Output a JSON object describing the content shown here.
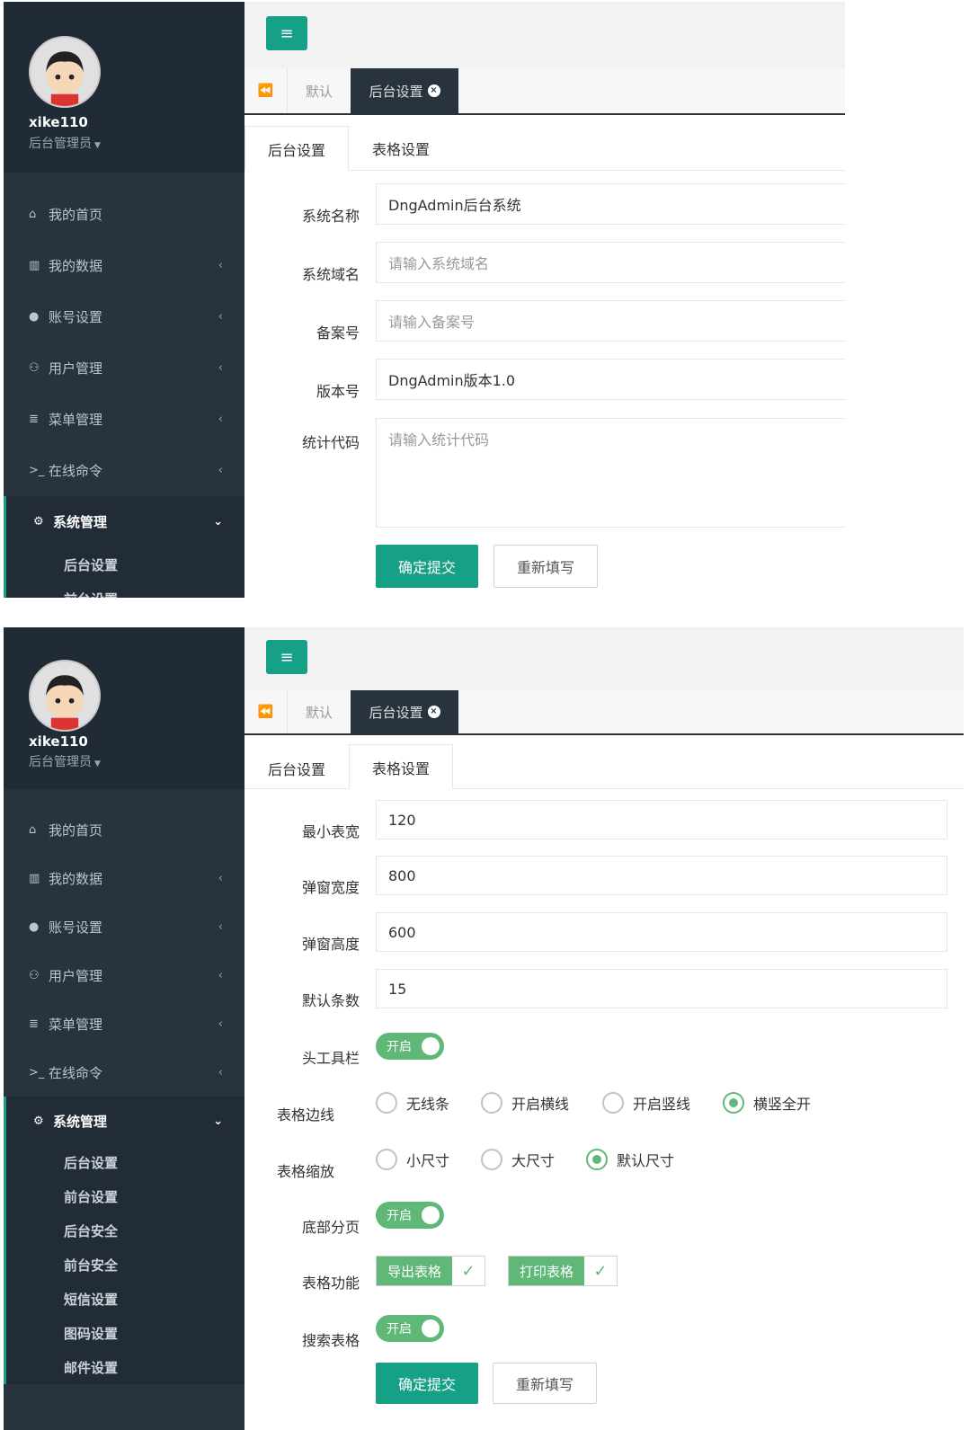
{
  "user": {
    "name": "xike110",
    "role": "后台管理员"
  },
  "menu": {
    "items": [
      {
        "label": "我的首页",
        "icon": "home-icon",
        "glyph": "⌂"
      },
      {
        "label": "我的数据",
        "icon": "bar-chart-icon",
        "glyph": "▥",
        "arrow": "‹"
      },
      {
        "label": "账号设置",
        "icon": "user-icon",
        "glyph": "●",
        "arrow": "‹"
      },
      {
        "label": "用户管理",
        "icon": "users-icon",
        "glyph": "⚇",
        "arrow": "‹"
      },
      {
        "label": "菜单管理",
        "icon": "list-icon",
        "glyph": "≣",
        "arrow": "‹"
      },
      {
        "label": "在线命令",
        "icon": "terminal-icon",
        "glyph": ">_",
        "arrow": "‹"
      },
      {
        "label": "系统管理",
        "icon": "gear-icon",
        "glyph": "⚙",
        "arrow": "⌄"
      }
    ],
    "submenu": [
      "后台设置",
      "前台设置",
      "后台安全",
      "前台安全",
      "短信设置",
      "图码设置",
      "邮件设置"
    ]
  },
  "header": {
    "menu_toggle_glyph": "≡"
  },
  "tabs": {
    "back_glyph": "⏪",
    "default": "默认",
    "active": "后台设置",
    "close_glyph": "×"
  },
  "subtabs": {
    "backend": "后台设置",
    "table": "表格设置"
  },
  "panel1": {
    "fields": {
      "sys_name": {
        "label": "系统名称",
        "value": "DngAdmin后台系统"
      },
      "domain": {
        "label": "系统域名",
        "placeholder": "请输入系统域名"
      },
      "icp": {
        "label": "备案号",
        "placeholder": "请输入备案号"
      },
      "version": {
        "label": "版本号",
        "value": "DngAdmin版本1.0"
      },
      "stats": {
        "label": "统计代码",
        "placeholder": "请输入统计代码"
      }
    }
  },
  "panel2": {
    "min_width": {
      "label": "最小表宽",
      "value": "120"
    },
    "popup_width": {
      "label": "弹窗宽度",
      "value": "800"
    },
    "popup_height": {
      "label": "弹窗高度",
      "value": "600"
    },
    "default_rows": {
      "label": "默认条数",
      "value": "15"
    },
    "toolbar": {
      "label": "头工具栏",
      "switch": "开启"
    },
    "border": {
      "label": "表格边线",
      "options": [
        "无线条",
        "开启横线",
        "开启竖线",
        "横竖全开"
      ],
      "selected": "横竖全开"
    },
    "scale": {
      "label": "表格缩放",
      "options": [
        "小尺寸",
        "大尺寸",
        "默认尺寸"
      ],
      "selected": "默认尺寸"
    },
    "paging": {
      "label": "底部分页",
      "switch": "开启"
    },
    "features": {
      "label": "表格功能",
      "export": "导出表格",
      "print": "打印表格",
      "check_glyph": "✓"
    },
    "search": {
      "label": "搜索表格",
      "switch": "开启"
    }
  },
  "buttons": {
    "submit": "确定提交",
    "reset": "重新填写"
  },
  "colors": {
    "sidebar": "#28333e",
    "accent": "#16a085",
    "switch_on": "#5fb878"
  }
}
